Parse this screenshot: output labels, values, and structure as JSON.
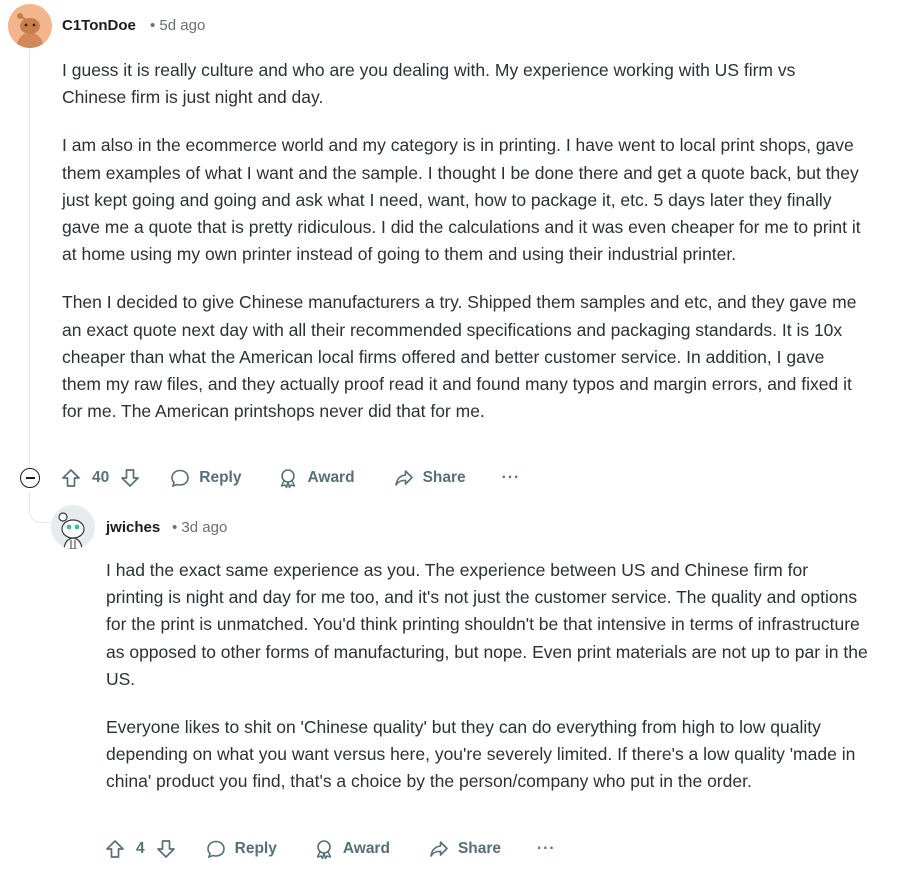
{
  "comments": [
    {
      "author": "C1TonDoe",
      "time": "• 5d ago",
      "paragraphs": [
        "I guess it is really culture and who are you dealing with. My experience working with US firm vs Chinese firm is just night and day.",
        "I am also in the ecommerce world and my category is in printing. I have went to local print shops, gave them examples of what I want and the sample. I thought I be done there and get a quote back, but they just kept going and going and ask what I need, want, how to package it, etc. 5 days later they finally gave me a quote that is pretty ridiculous. I did the calculations and it was even cheaper for me to print it at home using my own printer instead of going to them and using their industrial printer.",
        "Then I decided to give Chinese manufacturers a try. Shipped them samples and etc, and they gave me an exact quote next day with all their recommended specifications and packaging standards. It is 10x cheaper than what the American local firms offered and better customer service. In addition, I gave them my raw files, and they actually proof read it and found many typos and margin errors, and fixed it for me. The American printshops never did that for me."
      ],
      "score": "40",
      "reply_label": "Reply",
      "award_label": "Award",
      "share_label": "Share",
      "more_label": "···"
    },
    {
      "author": "jwiches",
      "time": "• 3d ago",
      "paragraphs": [
        "I had the exact same experience as you. The experience between US and Chinese firm for printing is night and day for me too, and it's not just the customer service. The quality and options for the print is unmatched. You'd think printing shouldn't be that intensive in terms of infrastructure as opposed to other forms of manufacturing, but nope. Even print materials are not up to par in the US.",
        "Everyone likes to shit on 'Chinese quality' but they can do everything from high to low quality depending on what you want versus here, you're severely limited. If there's a low quality 'made in china' product you find, that's a choice by the person/company who put in the order."
      ],
      "score": "4",
      "reply_label": "Reply",
      "award_label": "Award",
      "share_label": "Share",
      "more_label": "···"
    }
  ],
  "icons": {
    "upvote": "upvote-icon",
    "downvote": "downvote-icon",
    "reply": "reply-bubble-icon",
    "award": "award-icon",
    "share": "share-icon",
    "collapse": "collapse-thread-icon"
  }
}
